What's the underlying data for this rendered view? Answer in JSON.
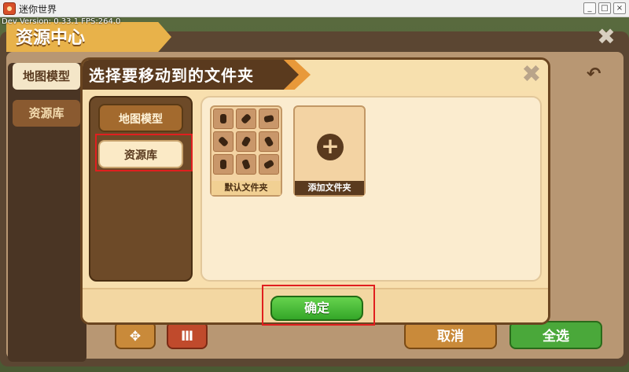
{
  "window": {
    "title": "迷你世界",
    "controls": [
      "_",
      "□",
      "×"
    ]
  },
  "dev_info": "Dev Version: 0.33.1    FPS:264.0",
  "background": {
    "title": "资源中心",
    "tabs": [
      "地图模型",
      "资源库"
    ],
    "buttons": {
      "cancel": "取消",
      "select_all": "全选"
    }
  },
  "modal": {
    "title": "选择要移动到的文件夹",
    "sidebar": [
      "地图模型",
      "资源库"
    ],
    "folders": {
      "default": "默认文件夹",
      "add": "添加文件夹"
    },
    "confirm": "确定"
  },
  "colors": {
    "accent_orange": "#e8993a",
    "confirm_green": "#4aa83a",
    "highlight_red": "#e01f1f"
  },
  "icons": [
    "app-icon",
    "close-icon",
    "back-arrow-icon",
    "move-icon",
    "trash-icon",
    "plus-icon"
  ]
}
